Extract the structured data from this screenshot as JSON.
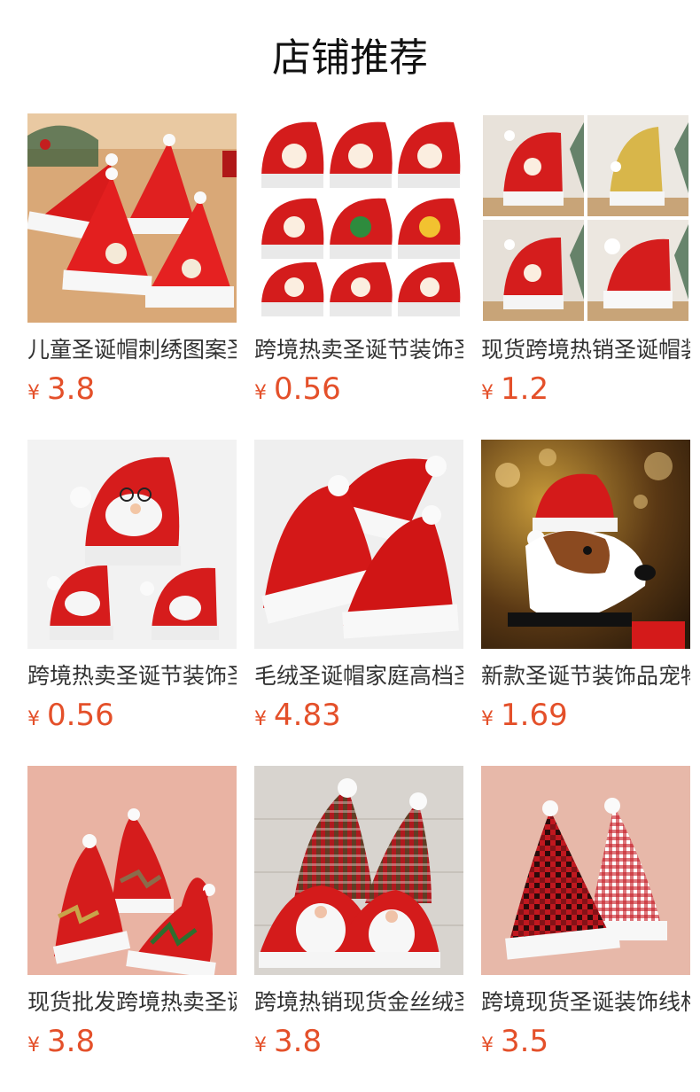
{
  "page": {
    "title": "店铺推荐"
  },
  "currency_symbol": "¥",
  "products": [
    {
      "name": "儿童圣诞帽刺绣图案圣诞帽",
      "price": "3.8",
      "image": "kids-embroidered-hats-on-wood"
    },
    {
      "name": "跨境热卖圣诞节装饰圣诞帽",
      "price": "0.56",
      "image": "nine-santa-hats-grid"
    },
    {
      "name": "现货跨境热销圣诞帽装饰",
      "price": "1.2",
      "image": "four-hats-collage"
    },
    {
      "name": "跨境热卖圣诞节装饰圣诞帽",
      "price": "0.56",
      "image": "santa-face-hats"
    },
    {
      "name": "毛绒圣诞帽家庭高档圣诞帽",
      "price": "4.83",
      "image": "plush-family-hats"
    },
    {
      "name": "新款圣诞节装饰品宠物圣诞帽",
      "price": "1.69",
      "image": "dog-wearing-hat"
    },
    {
      "name": "现货批发跨境热卖圣诞帽",
      "price": "3.8",
      "image": "antler-hats-on-wood"
    },
    {
      "name": "跨境热销现货金丝绒圣诞帽",
      "price": "3.8",
      "image": "gnome-plaid-hats"
    },
    {
      "name": "跨境现货圣诞装饰线格圣诞帽",
      "price": "3.5",
      "image": "checked-hats-on-wood"
    }
  ]
}
